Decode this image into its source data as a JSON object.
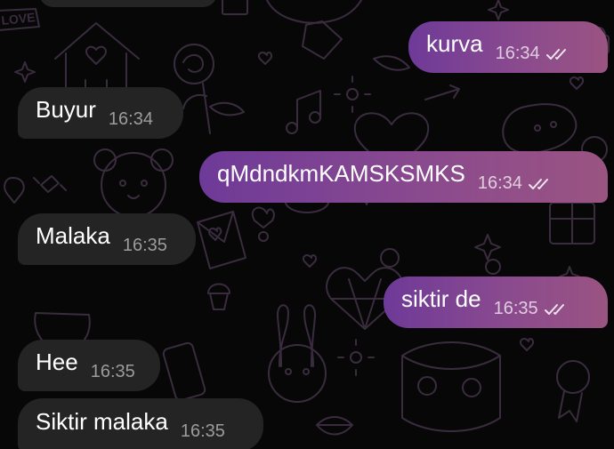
{
  "chat": {
    "messages": [
      {
        "direction": "outgoing",
        "text": "kurva",
        "time": "16:34",
        "status": "read"
      },
      {
        "direction": "incoming",
        "text": "Buyur",
        "time": "16:34"
      },
      {
        "direction": "outgoing",
        "text": "qMdndkmKAMSKSMKS",
        "time": "16:34",
        "status": "read"
      },
      {
        "direction": "incoming",
        "text": "Malaka",
        "time": "16:35"
      },
      {
        "direction": "outgoing",
        "text": "siktir de",
        "time": "16:35",
        "status": "read"
      },
      {
        "direction": "incoming",
        "text": "Hee",
        "time": "16:35"
      },
      {
        "direction": "incoming",
        "text": "Siktir malaka",
        "time": "16:35"
      }
    ],
    "wallpaper_text": "LOVE",
    "colors": {
      "background": "#070707",
      "incoming_bubble": "#242424",
      "outgoing_gradient_start": "#6e3a98",
      "outgoing_gradient_end": "#9a5482"
    },
    "icons": {
      "read_status": "double-check-icon"
    }
  }
}
